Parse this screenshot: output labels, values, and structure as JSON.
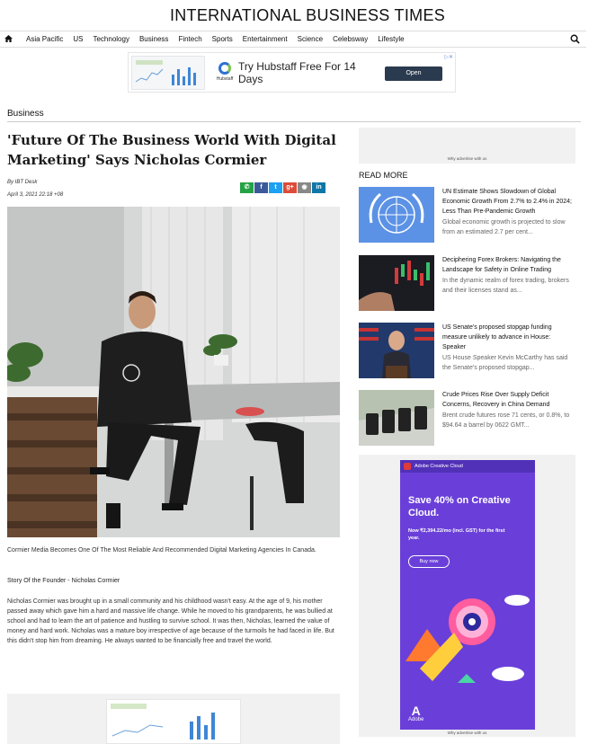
{
  "site": {
    "title": "INTERNATIONAL BUSINESS TIMES"
  },
  "nav": {
    "items": [
      "Asia Pacific",
      "US",
      "Technology",
      "Business",
      "Fintech",
      "Sports",
      "Entertainment",
      "Science",
      "Celebsway",
      "Lifestyle"
    ]
  },
  "ad_top": {
    "headline": "Try Hubstaff Free For 14 Days",
    "cta": "Open",
    "brand": "Hubstaff"
  },
  "section": "Business",
  "article": {
    "title": "'Future Of The Business World With Digital Marketing' Says Nicholas Cormier",
    "byline": "By IBT Desk",
    "date": "April 3, 2021 22:18 +08",
    "caption": "Cormier Media Becomes One Of The Most Reliable And Recommended Digital Marketing Agencies In Canada.",
    "subhead": "Story Of the Founder - Nicholas Cormier",
    "body": "Nicholas Cormier was brought up in a small community and his childhood wasn't easy. At the age of 9, his mother passed away which gave him a hard and massive life change. While he moved to his grandparents, he was bullied at school and had to learn the art of patience and hustling to survive school. It was then, Nicholas, learned the value of money and hard work. Nicholas was a mature boy irrespective of age because of the turmoils he had faced in life. But this didn't stop him from dreaming. He always wanted to be financially free and travel the world."
  },
  "sidebar": {
    "why_ads": "Why advertise with us",
    "read_more": "READ MORE",
    "items": [
      {
        "headline": "UN Estimate Shows Slowdown of Global Economic Growth From 2.7% to 2.4% in 2024; Less Than Pre-Pandemic Growth",
        "excerpt": "Global economic growth is projected to slow from an estimated 2.7 per cent..."
      },
      {
        "headline": "Deciphering Forex Brokers: Navigating the Landscape for Safety in Online Trading",
        "excerpt": "In the dynamic realm of forex trading, brokers and their licenses stand as..."
      },
      {
        "headline": "US Senate's proposed stopgap funding measure unlikely to advance in House: Speaker",
        "excerpt": "US House Speaker Kevin McCarthy has said the Senate's proposed stopgap..."
      },
      {
        "headline": "Crude Prices Rise Over Supply Deficit Concerns, Recovery in China Demand",
        "excerpt": "Brent crude futures rose 71 cents, or 0.8%, to $94.64 a barrel by 0622 GMT..."
      }
    ]
  },
  "ad_right": {
    "brand_bar": "Adobe Creative Cloud",
    "headline": "Save 40% on Creative Cloud.",
    "price": "Now ₹2,394.22/mo (incl. GST) for the first year.",
    "cta": "Buy now",
    "logo": "Adobe"
  },
  "colors": {
    "whatsapp": "#25a244",
    "facebook": "#3b5998",
    "twitter": "#1da1f2",
    "gplus": "#dd4b39",
    "reddit": "#888888",
    "linkedin": "#0e76a8",
    "adobe_purple": "#6a3fd9"
  }
}
